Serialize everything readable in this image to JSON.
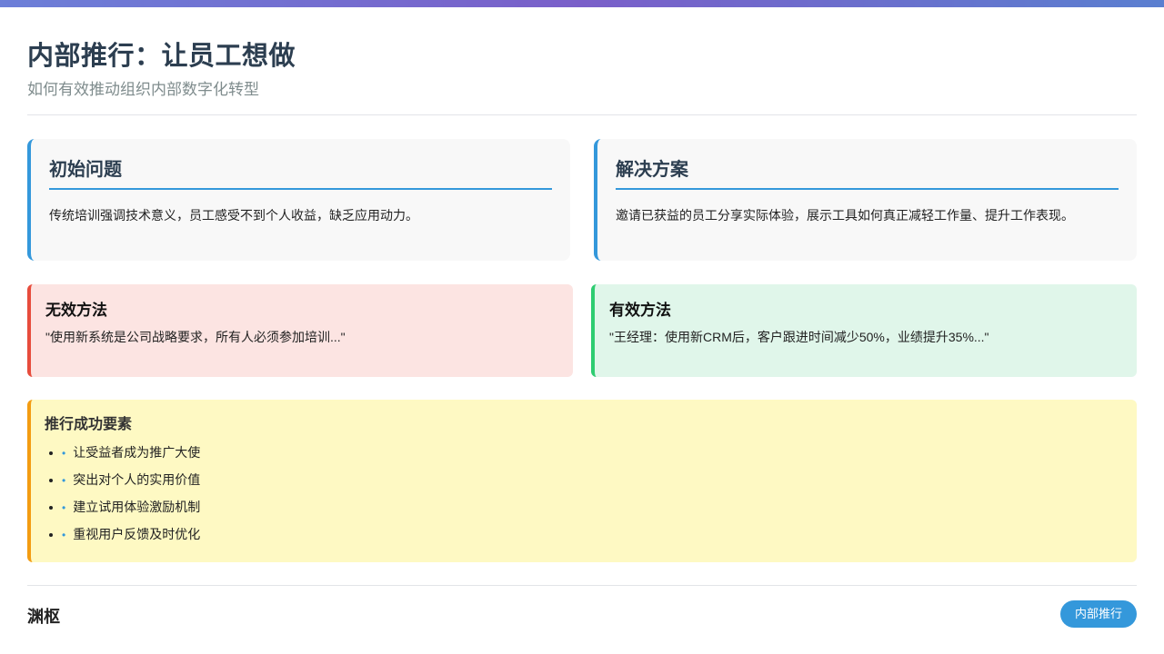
{
  "header": {
    "title": "内部推行：让员工想做",
    "subtitle": "如何有效推动组织内部数字化转型"
  },
  "cards": {
    "problem": {
      "title": "初始问题",
      "text": "传统培训强调技术意义，员工感受不到个人收益，缺乏应用动力。"
    },
    "solution": {
      "title": "解决方案",
      "text": "邀请已获益的员工分享实际体验，展示工具如何真正减轻工作量、提升工作表现。"
    }
  },
  "methods": {
    "bad": {
      "title": "无效方法",
      "text": "\"使用新系统是公司战略要求，所有人必须参加培训...\""
    },
    "good": {
      "title": "有效方法",
      "text": "\"王经理：使用新CRM后，客户跟进时间减少50%，业绩提升35%...\""
    }
  },
  "factors": {
    "title": "推行成功要素",
    "items": [
      "让受益者成为推广大使",
      "突出对个人的实用价值",
      "建立试用体验激励机制",
      "重视用户反馈及时优化"
    ]
  },
  "footer": {
    "brand": "渊枢",
    "tag": "内部推行"
  },
  "colors": {
    "accent": "#3498db",
    "bad": "#e74c3c",
    "good": "#2ecc71",
    "highlight": "#f39c12"
  }
}
